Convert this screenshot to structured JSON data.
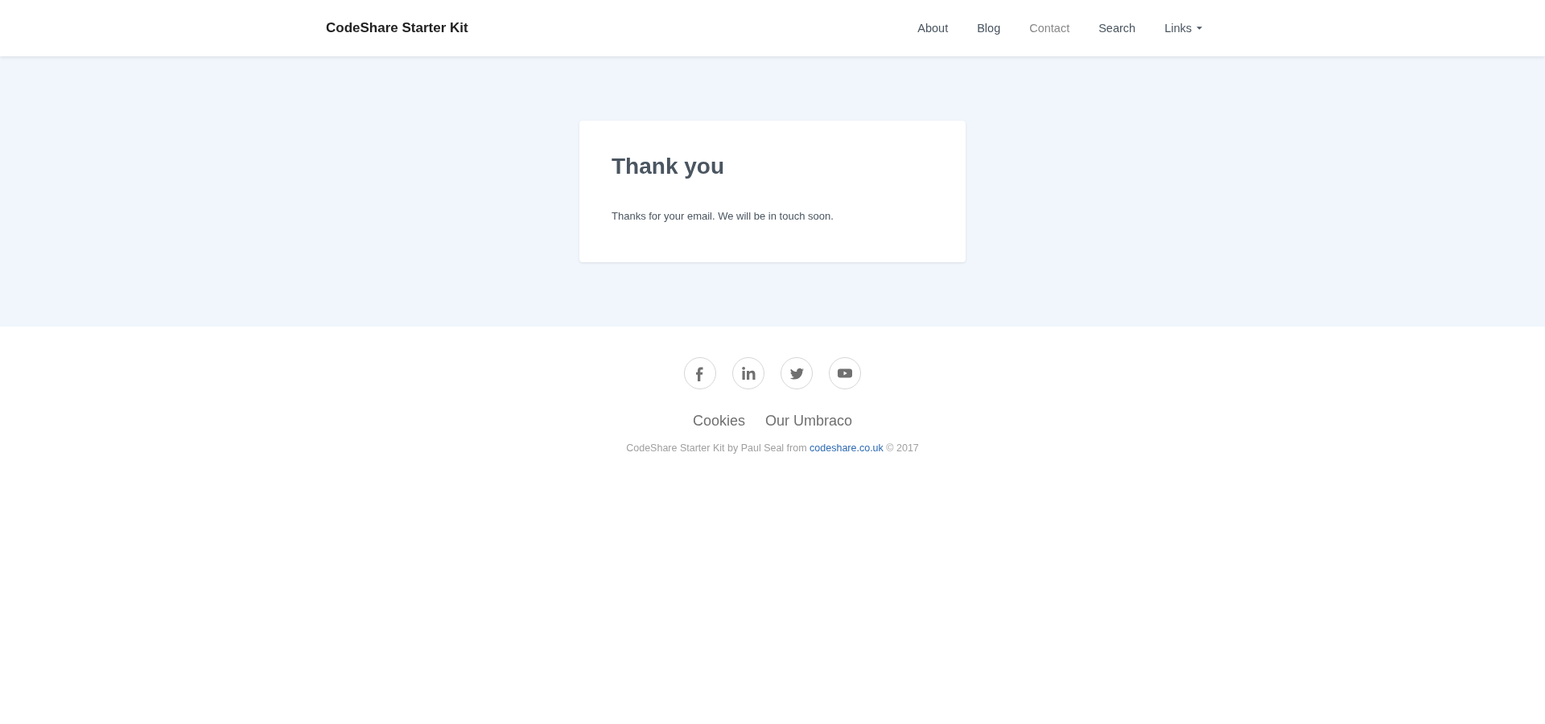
{
  "navbar": {
    "brand": "CodeShare Starter Kit",
    "items": [
      {
        "label": "About",
        "selected": false,
        "dropdown": false
      },
      {
        "label": "Blog",
        "selected": false,
        "dropdown": false
      },
      {
        "label": "Contact",
        "selected": true,
        "dropdown": false
      },
      {
        "label": "Search",
        "selected": false,
        "dropdown": false
      },
      {
        "label": "Links",
        "selected": false,
        "dropdown": true
      }
    ]
  },
  "card": {
    "title": "Thank you",
    "message": "Thanks for your email. We will be in touch soon."
  },
  "footer": {
    "links": [
      "Cookies",
      "Our Umbraco"
    ],
    "credit": {
      "before": "CodeShare Starter Kit by Paul Seal from",
      "link": "codeshare.co.uk",
      "after": "© 2017"
    }
  }
}
